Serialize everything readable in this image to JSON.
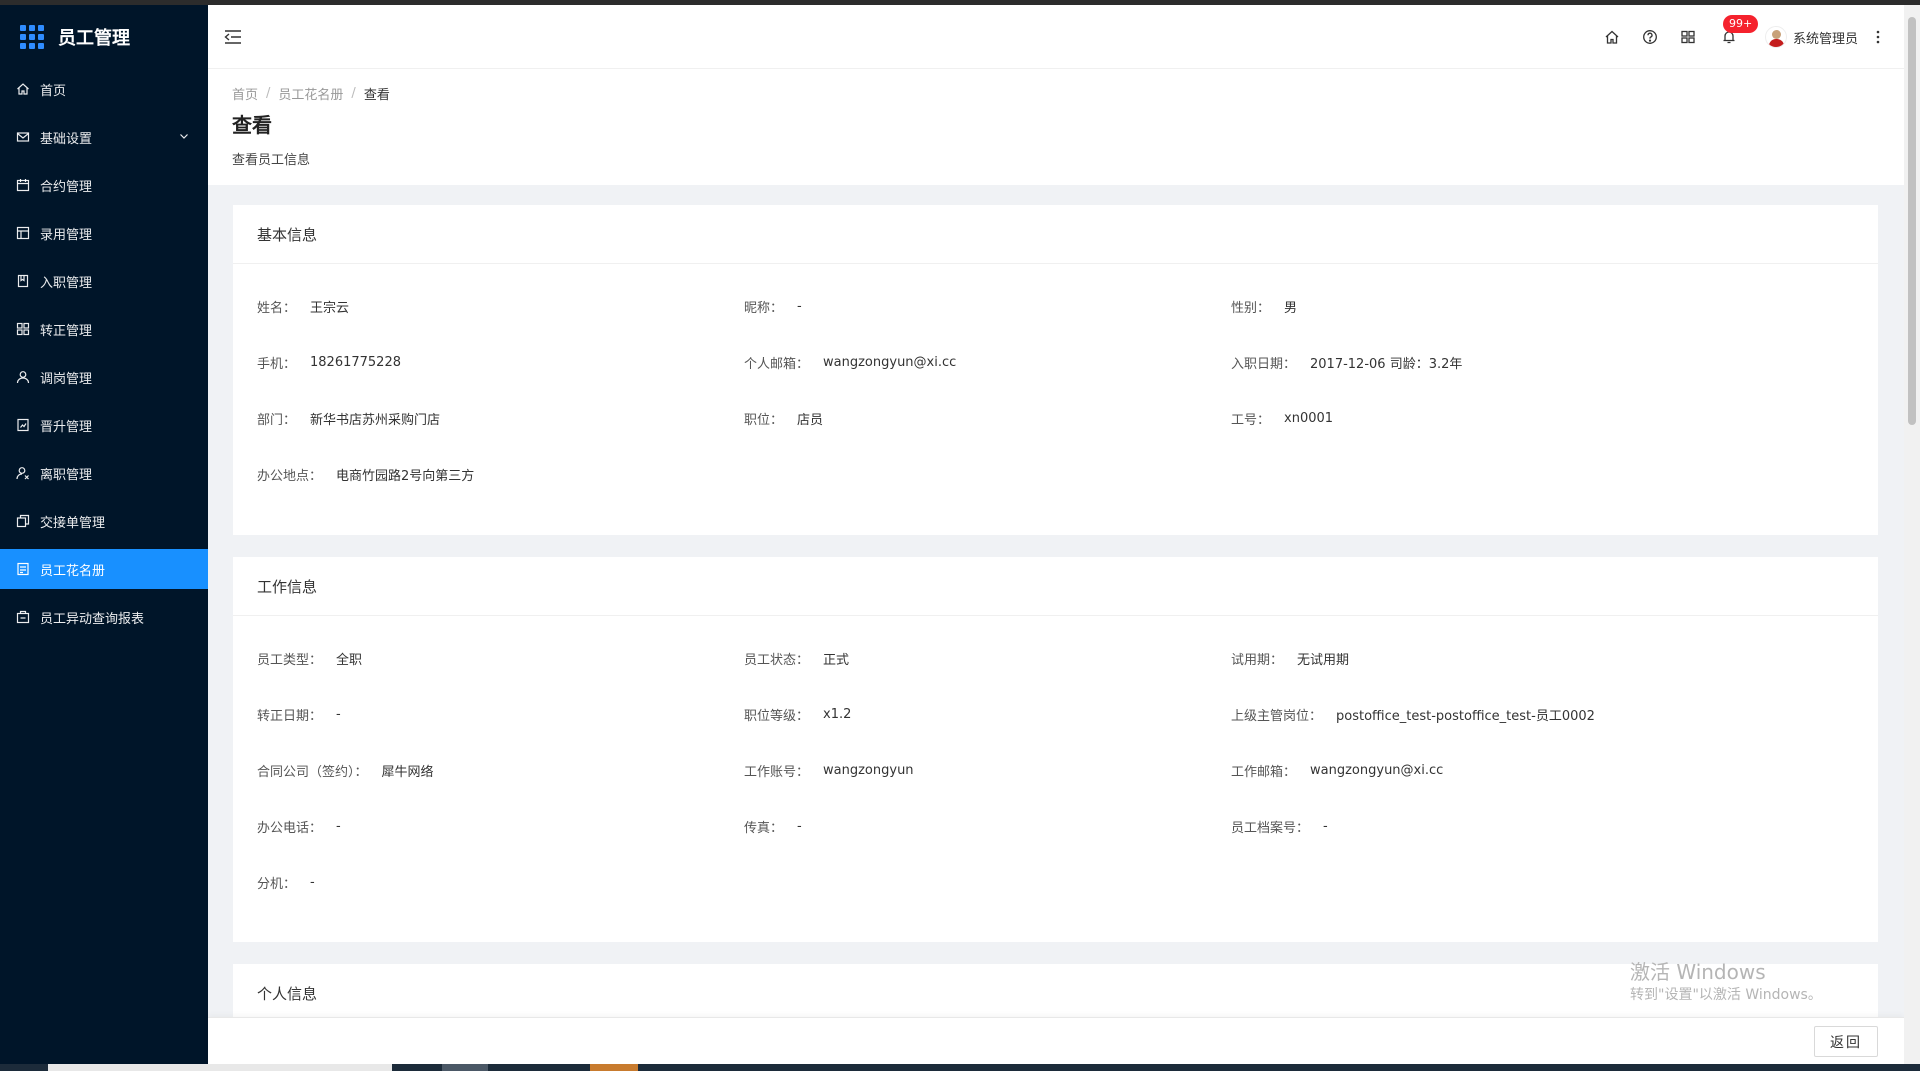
{
  "app": {
    "title": "员工管理"
  },
  "sidebar": {
    "items": [
      {
        "label": "首页",
        "icon": "home-icon"
      },
      {
        "label": "基础设置",
        "icon": "mail-icon",
        "expandable": true
      },
      {
        "label": "合约管理",
        "icon": "calendar-icon"
      },
      {
        "label": "录用管理",
        "icon": "layout-icon"
      },
      {
        "label": "入职管理",
        "icon": "book-icon"
      },
      {
        "label": "转正管理",
        "icon": "cluster-icon"
      },
      {
        "label": "调岗管理",
        "icon": "user-icon"
      },
      {
        "label": "晋升管理",
        "icon": "rise-icon"
      },
      {
        "label": "离职管理",
        "icon": "user-delete-icon"
      },
      {
        "label": "交接单管理",
        "icon": "copy-icon"
      },
      {
        "label": "员工花名册",
        "icon": "profile-icon",
        "active": true
      },
      {
        "label": "员工异动查询报表",
        "icon": "report-icon"
      }
    ]
  },
  "header": {
    "notification_count": "99+",
    "user_name": "系统管理员"
  },
  "page": {
    "breadcrumb": [
      "首页",
      "员工花名册",
      "查看"
    ],
    "title": "查看",
    "description": "查看员工信息"
  },
  "sections": [
    {
      "title": "基本信息",
      "fields": [
        {
          "label": "姓名：",
          "value": "王宗云"
        },
        {
          "label": "昵称：",
          "value": "-"
        },
        {
          "label": "性别：",
          "value": "男"
        },
        {
          "label": "手机：",
          "value": "18261775228"
        },
        {
          "label": "个人邮箱：",
          "value": "wangzongyun@xi.cc"
        },
        {
          "label": "入职日期：",
          "value": "2017-12-06  司龄：3.2年"
        },
        {
          "label": "部门：",
          "value": "新华书店苏州采购门店"
        },
        {
          "label": "职位：",
          "value": "店员"
        },
        {
          "label": "工号：",
          "value": "xn0001"
        },
        {
          "label": "办公地点：",
          "value": "电商竹园路2号向第三方"
        }
      ]
    },
    {
      "title": "工作信息",
      "fields": [
        {
          "label": "员工类型：",
          "value": "全职"
        },
        {
          "label": "员工状态：",
          "value": "正式"
        },
        {
          "label": "试用期：",
          "value": "无试用期"
        },
        {
          "label": "转正日期：",
          "value": "-"
        },
        {
          "label": "职位等级：",
          "value": "x1.2"
        },
        {
          "label": "上级主管岗位：",
          "value": "postoffice_test-postoffice_test-员工0002"
        },
        {
          "label": "合同公司（签约）：",
          "value": "犀牛网络"
        },
        {
          "label": "工作账号：",
          "value": "wangzongyun"
        },
        {
          "label": "工作邮箱：",
          "value": "wangzongyun@xi.cc"
        },
        {
          "label": "办公电话：",
          "value": "-"
        },
        {
          "label": "传真：",
          "value": "-"
        },
        {
          "label": "员工档案号：",
          "value": "-"
        },
        {
          "label": "分机：",
          "value": "-"
        }
      ]
    },
    {
      "title": "个人信息",
      "fields": []
    }
  ],
  "footer": {
    "back_label": "返回"
  },
  "watermark": {
    "line1": "激活 Windows",
    "line2": "转到\"设置\"以激活 Windows。"
  },
  "colors": {
    "sidebar_bg": "#001529",
    "active": "#1890ff",
    "badge": "#f5222d"
  }
}
